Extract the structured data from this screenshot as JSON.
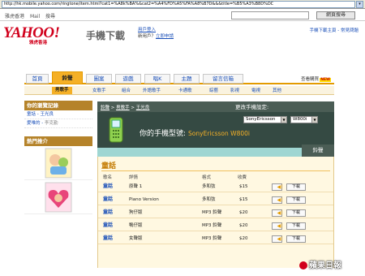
{
  "browser": {
    "url": "http://hk.mobile.yahoo.com/ringtone/item.html?cat1=%A8k%BA%&cat2=%A4%FD%A5%FA%A8%B7D&&&title=%B5%A3%B8D%DC"
  },
  "yahoo_nav": {
    "links": [
      "雅虎香港",
      "Mail",
      "搜尋"
    ],
    "search_button": "網頁搜尋"
  },
  "header": {
    "logo": "YAHOO!",
    "logo_sub": "雅虎香港",
    "service": "手機下載",
    "user_line1": "用戶登入",
    "user_line2_prefix": "新用戶？",
    "user_line2_link": "立即申請",
    "top_links": "手機下載主頁 - 常見問題"
  },
  "main_nav": {
    "tabs": [
      {
        "label": "首頁"
      },
      {
        "label": "鈴聲"
      },
      {
        "label": "圖案"
      },
      {
        "label": "遊戲"
      },
      {
        "label": "唱K"
      },
      {
        "label": "主題"
      },
      {
        "label": "留言信箱"
      }
    ],
    "my_link": "查看購買",
    "new_badge": "NEW"
  },
  "sub_nav": {
    "items": [
      "男歌手",
      "女歌手",
      "組合",
      "外語歌手",
      "卡通歌",
      "綜藝",
      "影視",
      "電視",
      "其他"
    ]
  },
  "sidebar": {
    "history_title": "你的瀏覽記錄",
    "history_items": [
      {
        "label": "童話 - 王光良",
        "dim": ""
      },
      {
        "label": "愛唯的 - ",
        "dim": "李克勤"
      }
    ],
    "recommend_title": "熱門推介"
  },
  "breadcrumb": {
    "items": [
      "鈴聲",
      "男歌手",
      "王光良"
    ]
  },
  "phone_settings": {
    "change_label": "更改手機設定:",
    "brand": "SonyEricsson",
    "model_select": "W800i",
    "model_prefix": "你的手機型號:",
    "model_value": "SonyEricsson W800i"
  },
  "section_tag": "鈴聲",
  "content": {
    "title": "童話",
    "headers": [
      "歌名",
      "詳情",
      "格式",
      "收費"
    ],
    "rows": [
      {
        "song": "童話",
        "detail": "原聲 1",
        "format": "多和弦",
        "price": "$15"
      },
      {
        "song": "童話",
        "detail": "Piano Version",
        "format": "多和弦",
        "price": "$15"
      },
      {
        "song": "童話",
        "detail": "狗仔版",
        "format": "MP3 鈴聲",
        "price": "$20"
      },
      {
        "song": "童話",
        "detail": "鴨仔版",
        "format": "MP3 鈴聲",
        "price": "$20"
      },
      {
        "song": "童話",
        "detail": "女聲版",
        "format": "MP3 鈴聲",
        "price": "$20"
      }
    ],
    "download_label": "下載"
  },
  "watermark": "蘋果日報",
  "colors": {
    "brand_red": "#d1001c",
    "accent_orange": "#f5b026",
    "dark_green": "#354a43",
    "teal": "#9fd6d2",
    "link_blue": "#1a4fb8"
  }
}
